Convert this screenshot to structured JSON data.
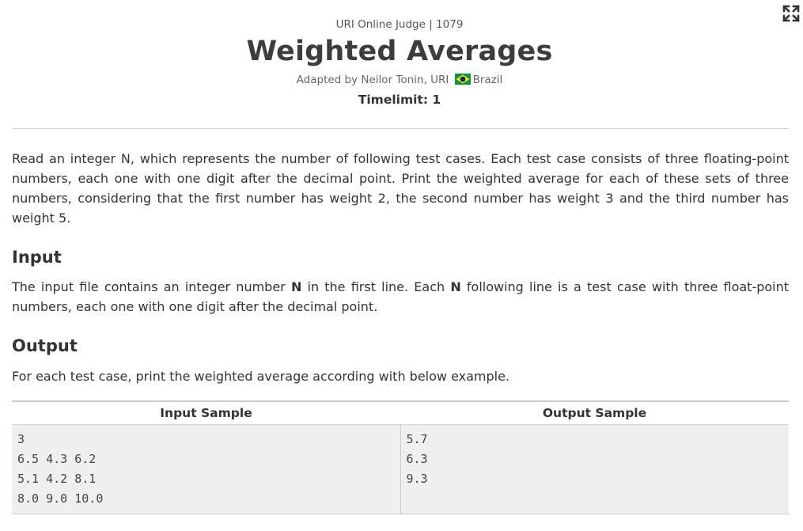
{
  "header": {
    "judge_line": "URI Online Judge | 1079",
    "title": "Weighted Averages",
    "author_prefix": "Adapted by Neilor Tonin, URI",
    "author_country": "Brazil",
    "timelimit": "Timelimit: 1"
  },
  "icons": {
    "expand": "fullscreen-expand-icon",
    "flag": "brazil-flag-icon"
  },
  "colors": {
    "text": "#333333",
    "table_bg": "#efefef",
    "divider": "#cfcfcf",
    "flag_green": "#009c3b",
    "flag_yellow": "#ffdf00",
    "flag_blue": "#002776"
  },
  "description": "Read an integer N, which represents the number of following test cases. Each test case consists of three floating-point numbers, each one with one digit after the decimal point. Print the weighted average for each of these sets of three numbers, considering that the first number has weight 2, the second number has weight 3 and the third number has weight 5.",
  "input": {
    "title": "Input",
    "text_1": "The input file contains an integer number ",
    "bold_1": "N",
    "text_2": " in the first line. Each ",
    "bold_2": "N",
    "text_3": " following line is a test case with three float-point numbers, each one with one digit after the decimal point."
  },
  "output": {
    "title": "Output",
    "text": "For each test case, print the weighted average according with below example."
  },
  "samples": {
    "input_header": "Input Sample",
    "output_header": "Output Sample",
    "input_lines": [
      "3",
      "6.5 4.3 6.2",
      "5.1 4.2 8.1",
      "8.0 9.0 10.0"
    ],
    "output_lines": [
      "5.7",
      "6.3",
      "9.3"
    ]
  }
}
